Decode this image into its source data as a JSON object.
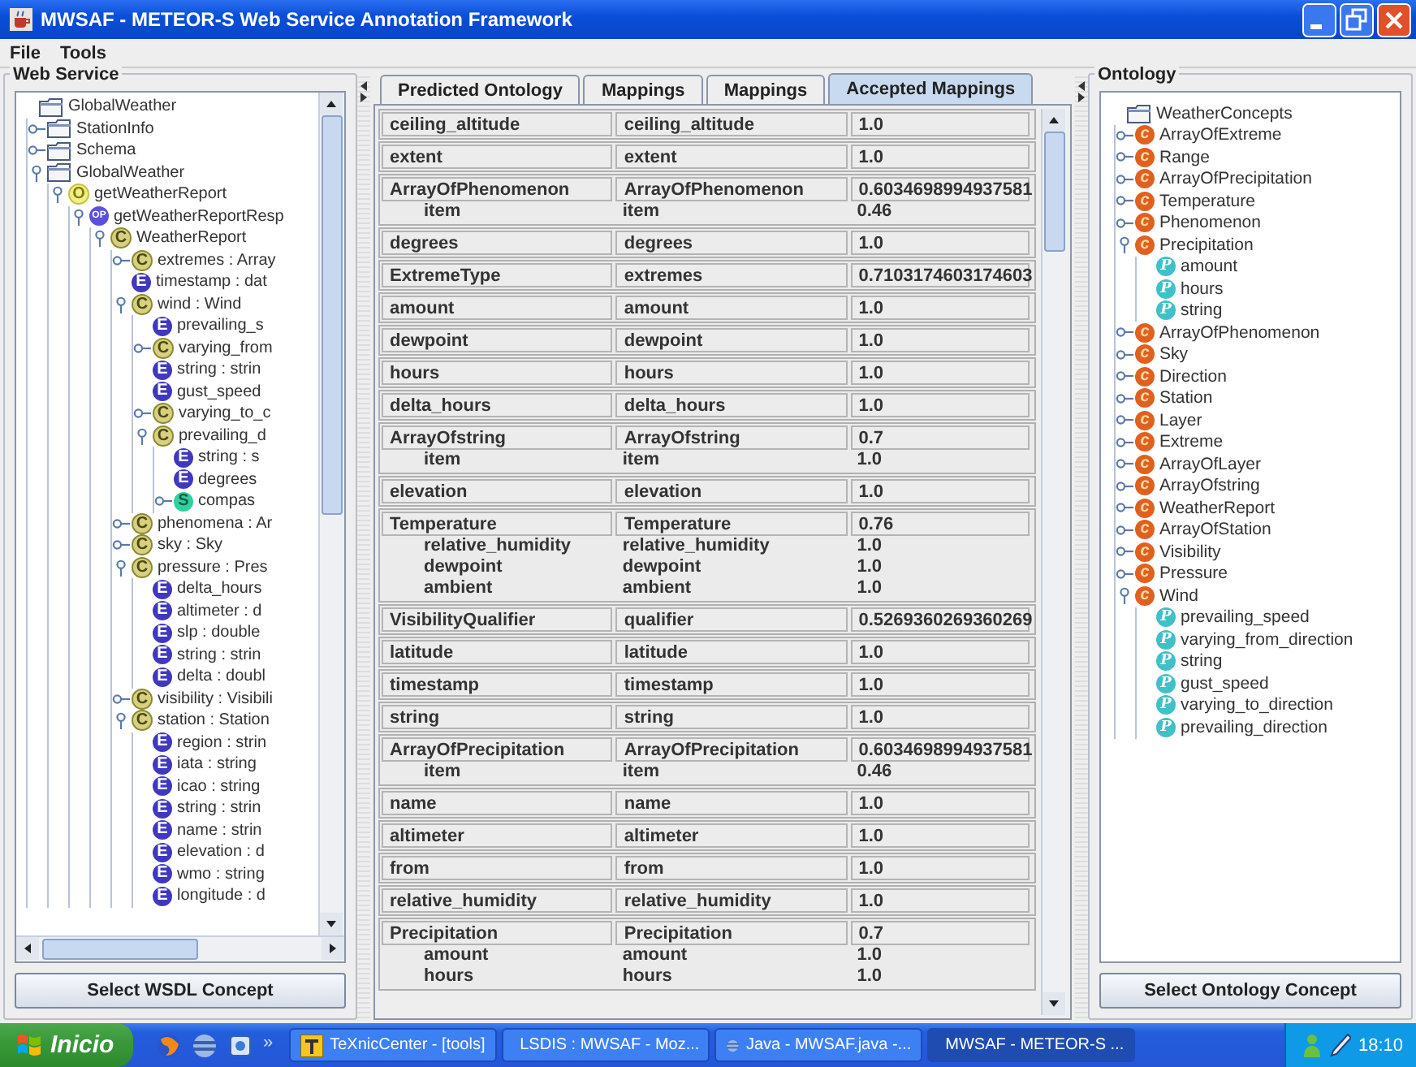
{
  "window": {
    "title": "MWSAF - METEOR-S Web Service Annotation Framework"
  },
  "menu": [
    "File",
    "Tools"
  ],
  "web_service": {
    "title": "Web Service",
    "button": "Select WSDL Concept",
    "tree": [
      {
        "label": "GlobalWeather",
        "kind": "folder",
        "children": [
          {
            "label": "StationInfo",
            "kind": "folder",
            "expanded": false
          },
          {
            "label": "Schema",
            "kind": "folder",
            "expanded": false
          },
          {
            "label": "GlobalWeather",
            "kind": "folder",
            "expanded": true,
            "children": [
              {
                "label": "getWeatherReport",
                "kind": "operation",
                "badge": "O",
                "expanded": true,
                "children": [
                  {
                    "label": "getWeatherReportResp",
                    "kind": "message",
                    "badge": "OP",
                    "expanded": true,
                    "children": [
                      {
                        "label": "WeatherReport",
                        "kind": "complex",
                        "badge": "C",
                        "expanded": true,
                        "children": [
                          {
                            "label": "extremes : Array",
                            "kind": "complex",
                            "badge": "C",
                            "expanded": false
                          },
                          {
                            "label": "timestamp : dat",
                            "kind": "element",
                            "badge": "E"
                          },
                          {
                            "label": "wind : Wind",
                            "kind": "complex",
                            "badge": "C",
                            "expanded": true,
                            "children": [
                              {
                                "label": "prevailing_s",
                                "kind": "element",
                                "badge": "E"
                              },
                              {
                                "label": "varying_from",
                                "kind": "complex",
                                "badge": "C",
                                "expanded": false
                              },
                              {
                                "label": "string : strin",
                                "kind": "element",
                                "badge": "E"
                              },
                              {
                                "label": "gust_speed",
                                "kind": "element",
                                "badge": "E"
                              },
                              {
                                "label": "varying_to_c",
                                "kind": "complex",
                                "badge": "C",
                                "expanded": false
                              },
                              {
                                "label": "prevailing_d",
                                "kind": "complex",
                                "badge": "C",
                                "expanded": true,
                                "children": [
                                  {
                                    "label": "string : s",
                                    "kind": "element",
                                    "badge": "E"
                                  },
                                  {
                                    "label": "degrees",
                                    "kind": "element",
                                    "badge": "E"
                                  },
                                  {
                                    "label": "compas",
                                    "kind": "simple",
                                    "badge": "S",
                                    "expanded": false
                                  }
                                ]
                              }
                            ]
                          },
                          {
                            "label": "phenomena : Ar",
                            "kind": "complex",
                            "badge": "C",
                            "expanded": false
                          },
                          {
                            "label": "sky : Sky",
                            "kind": "complex",
                            "badge": "C",
                            "expanded": false
                          },
                          {
                            "label": "pressure : Pres",
                            "kind": "complex",
                            "badge": "C",
                            "expanded": true,
                            "children": [
                              {
                                "label": "delta_hours",
                                "kind": "element",
                                "badge": "E"
                              },
                              {
                                "label": "altimeter : d",
                                "kind": "element",
                                "badge": "E"
                              },
                              {
                                "label": "slp : double",
                                "kind": "element",
                                "badge": "E"
                              },
                              {
                                "label": "string : strin",
                                "kind": "element",
                                "badge": "E"
                              },
                              {
                                "label": "delta : doubl",
                                "kind": "element",
                                "badge": "E"
                              }
                            ]
                          },
                          {
                            "label": "visibility : Visibili",
                            "kind": "complex",
                            "badge": "C",
                            "expanded": false
                          },
                          {
                            "label": "station : Station",
                            "kind": "complex",
                            "badge": "C",
                            "expanded": true,
                            "children": [
                              {
                                "label": "region : strin",
                                "kind": "element",
                                "badge": "E"
                              },
                              {
                                "label": "iata : string",
                                "kind": "element",
                                "badge": "E"
                              },
                              {
                                "label": "icao : string",
                                "kind": "element",
                                "badge": "E"
                              },
                              {
                                "label": "string : strin",
                                "kind": "element",
                                "badge": "E"
                              },
                              {
                                "label": "name : strin",
                                "kind": "element",
                                "badge": "E"
                              },
                              {
                                "label": "elevation : d",
                                "kind": "element",
                                "badge": "E"
                              },
                              {
                                "label": "wmo : string",
                                "kind": "element",
                                "badge": "E"
                              },
                              {
                                "label": "longitude : d",
                                "kind": "element",
                                "badge": "E"
                              }
                            ]
                          }
                        ]
                      }
                    ]
                  }
                ]
              }
            ]
          }
        ]
      }
    ]
  },
  "tabs": [
    {
      "label": "Predicted Ontology",
      "selected": false
    },
    {
      "label": "Mappings",
      "selected": false
    },
    {
      "label": "Mappings",
      "selected": false
    },
    {
      "label": "Accepted Mappings",
      "selected": true
    }
  ],
  "mappings": [
    {
      "source": "ceiling_altitude",
      "target": "ceiling_altitude",
      "score": "1.0"
    },
    {
      "source": "extent",
      "target": "extent",
      "score": "1.0"
    },
    {
      "source": "ArrayOfPhenomenon",
      "target": "ArrayOfPhenomenon",
      "score": "0.6034698994937581",
      "children": [
        {
          "source": "item",
          "target": "item",
          "score": "0.46"
        }
      ]
    },
    {
      "source": "degrees",
      "target": "degrees",
      "score": "1.0"
    },
    {
      "source": "ExtremeType",
      "target": "extremes",
      "score": "0.7103174603174603"
    },
    {
      "source": "amount",
      "target": "amount",
      "score": "1.0"
    },
    {
      "source": "dewpoint",
      "target": "dewpoint",
      "score": "1.0"
    },
    {
      "source": "hours",
      "target": "hours",
      "score": "1.0"
    },
    {
      "source": "delta_hours",
      "target": "delta_hours",
      "score": "1.0"
    },
    {
      "source": "ArrayOfstring",
      "target": "ArrayOfstring",
      "score": "0.7",
      "children": [
        {
          "source": "item",
          "target": "item",
          "score": "1.0"
        }
      ]
    },
    {
      "source": "elevation",
      "target": "elevation",
      "score": "1.0"
    },
    {
      "source": "Temperature",
      "target": "Temperature",
      "score": "0.76",
      "children": [
        {
          "source": "relative_humidity",
          "target": "relative_humidity",
          "score": "1.0"
        },
        {
          "source": "dewpoint",
          "target": "dewpoint",
          "score": "1.0"
        },
        {
          "source": "ambient",
          "target": "ambient",
          "score": "1.0"
        }
      ]
    },
    {
      "source": "VisibilityQualifier",
      "target": "qualifier",
      "score": "0.5269360269360269"
    },
    {
      "source": "latitude",
      "target": "latitude",
      "score": "1.0"
    },
    {
      "source": "timestamp",
      "target": "timestamp",
      "score": "1.0"
    },
    {
      "source": "string",
      "target": "string",
      "score": "1.0"
    },
    {
      "source": "ArrayOfPrecipitation",
      "target": "ArrayOfPrecipitation",
      "score": "0.6034698994937581",
      "children": [
        {
          "source": "item",
          "target": "item",
          "score": "0.46"
        }
      ]
    },
    {
      "source": "name",
      "target": "name",
      "score": "1.0"
    },
    {
      "source": "altimeter",
      "target": "altimeter",
      "score": "1.0"
    },
    {
      "source": "from",
      "target": "from",
      "score": "1.0"
    },
    {
      "source": "relative_humidity",
      "target": "relative_humidity",
      "score": "1.0"
    },
    {
      "source": "Precipitation",
      "target": "Precipitation",
      "score": "0.7",
      "children": [
        {
          "source": "amount",
          "target": "amount",
          "score": "1.0"
        },
        {
          "source": "hours",
          "target": "hours",
          "score": "1.0"
        }
      ]
    }
  ],
  "ontology": {
    "title": "Ontology",
    "button": "Select Ontology Concept",
    "tree": [
      {
        "label": "WeatherConcepts",
        "kind": "folder",
        "children": [
          {
            "label": "ArrayOfExtreme",
            "kind": "class",
            "badge": "c",
            "expanded": false
          },
          {
            "label": "Range",
            "kind": "class",
            "badge": "c",
            "expanded": false
          },
          {
            "label": "ArrayOfPrecipitation",
            "kind": "class",
            "badge": "c",
            "expanded": false
          },
          {
            "label": "Temperature",
            "kind": "class",
            "badge": "c",
            "expanded": false
          },
          {
            "label": "Phenomenon",
            "kind": "class",
            "badge": "c",
            "expanded": false
          },
          {
            "label": "Precipitation",
            "kind": "class",
            "badge": "c",
            "expanded": true,
            "children": [
              {
                "label": "amount",
                "kind": "property",
                "badge": "P"
              },
              {
                "label": "hours",
                "kind": "property",
                "badge": "P"
              },
              {
                "label": "string",
                "kind": "property",
                "badge": "P"
              }
            ]
          },
          {
            "label": "ArrayOfPhenomenon",
            "kind": "class",
            "badge": "c",
            "expanded": false
          },
          {
            "label": "Sky",
            "kind": "class",
            "badge": "c",
            "expanded": false
          },
          {
            "label": "Direction",
            "kind": "class",
            "badge": "c",
            "expanded": false
          },
          {
            "label": "Station",
            "kind": "class",
            "badge": "c",
            "expanded": false
          },
          {
            "label": "Layer",
            "kind": "class",
            "badge": "c",
            "expanded": false
          },
          {
            "label": "Extreme",
            "kind": "class",
            "badge": "c",
            "expanded": false
          },
          {
            "label": "ArrayOfLayer",
            "kind": "class",
            "badge": "c",
            "expanded": false
          },
          {
            "label": "ArrayOfstring",
            "kind": "class",
            "badge": "c",
            "expanded": false
          },
          {
            "label": "WeatherReport",
            "kind": "class",
            "badge": "c",
            "expanded": false
          },
          {
            "label": "ArrayOfStation",
            "kind": "class",
            "badge": "c",
            "expanded": false
          },
          {
            "label": "Visibility",
            "kind": "class",
            "badge": "c",
            "expanded": false
          },
          {
            "label": "Pressure",
            "kind": "class",
            "badge": "c",
            "expanded": false
          },
          {
            "label": "Wind",
            "kind": "class",
            "badge": "c",
            "expanded": true,
            "children": [
              {
                "label": "prevailing_speed",
                "kind": "property",
                "badge": "P"
              },
              {
                "label": "varying_from_direction",
                "kind": "property",
                "badge": "P"
              },
              {
                "label": "string",
                "kind": "property",
                "badge": "P"
              },
              {
                "label": "gust_speed",
                "kind": "property",
                "badge": "P"
              },
              {
                "label": "varying_to_direction",
                "kind": "property",
                "badge": "P"
              },
              {
                "label": "prevailing_direction",
                "kind": "property",
                "badge": "P"
              }
            ]
          }
        ]
      }
    ]
  },
  "taskbar": {
    "start": "Inicio",
    "more": "»",
    "clock": "18:10",
    "tasks": [
      {
        "label": "TeXnicCenter - [tools]",
        "kind": "editor",
        "selected": false
      },
      {
        "label": "LSDIS : MWSAF - Moz...",
        "kind": "browser",
        "selected": false
      },
      {
        "label": "Java - MWSAF.java -...",
        "kind": "ide",
        "selected": false
      },
      {
        "label": "MWSAF - METEOR-S ...",
        "kind": "app",
        "selected": true
      }
    ]
  }
}
